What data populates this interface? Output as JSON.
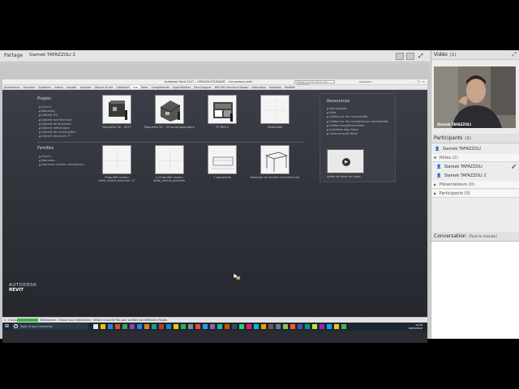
{
  "share": {
    "title": "Partage",
    "presenter": "Siamek TAFAZZOLI 2"
  },
  "revit": {
    "window_title": "Autodesk Revit 2017 – VERSION ÉTUDIANT –  Connexions aide",
    "search_placeholder": "Entrez un mot-clé ou une expression",
    "user": "siamek9 ▾",
    "ribbon_tabs": [
      "Architecture",
      "Structure",
      "Systèmes",
      "Insérer",
      "Annoter",
      "Analyser",
      "Volume et site",
      "Collaborer",
      "Vue",
      "Gérer",
      "Compléments",
      "Quantification",
      "Site Designer",
      "BIM 360 Structural Design",
      "Fabrication",
      "Autodesk",
      "Modifier"
    ],
    "active_tab_index": 8,
    "projects": {
      "title": "Projets",
      "links": [
        "Ouvrir...",
        "Nouveau...",
        "Gabarit BT...",
        "Gabarit architectural",
        "Gabarit de structure",
        "Gabarit mécanique",
        "Gabarit de construction",
        "Gabarit structure TT"
      ],
      "thumbs": [
        {
          "caption": "Maquette 30 - 2017"
        },
        {
          "caption": "Maquette 20 - 18 accompagnateur"
        },
        {
          "caption": "TP REV-2"
        },
        {
          "caption": "Modifiable"
        }
      ]
    },
    "families": {
      "title": "Familles",
      "links": [
        "Ouvrir...",
        "Nouveau...",
        "Nouveau volume conceptuel..."
      ],
      "thumbs": [
        {
          "caption": "Propriété niveau dalle_contre_plancher 17"
        },
        {
          "caption": "b_Propriété niveau dalle_contre_plancher"
        },
        {
          "caption": "1 passerelle"
        },
        {
          "caption": "Exemple de famille d'architecture"
        }
      ]
    },
    "resources": {
      "title": "Ressources",
      "links": [
        "Nouveautés",
        "Aide",
        "Vidéos sur les nouveautés",
        "Vidéos sur les compétences essentielles",
        "Vidéos supplémentaires",
        "Autodesk App Store",
        "Communauté Revit"
      ],
      "video_caption": "Vidéo de mise en route"
    },
    "logo_line1": "AUTODESK",
    "logo_line2": "REVIT",
    "status_left": "0 : 0 Modèle",
    "status_text": "Sélectionner : Cliquez pour sélectionner. Utilisez la touche Tab pour accéder aux éléments d'angle."
  },
  "taskbar": {
    "search_placeholder": "Taper ici pour rechercher",
    "time": "14:38",
    "date": "26/03/2020"
  },
  "right": {
    "video_title": "Vidéo",
    "video_count": "(1)",
    "video_name": "Siamek TAFAZZOLI",
    "participants_title": "Participants",
    "participants_count": "(2)",
    "me": "Siamek TAFAZZOLI",
    "hosts_label": "Hôtes (2)",
    "hosts": [
      "Siamek TAFAZZOLI",
      "Siamek TAFAZZOLI 2"
    ],
    "presenters_label": "Présentateurs (0)",
    "participants_label": "Participants (0)",
    "conversation_title": "Conversation",
    "conversation_scope": "(Tout le monde)"
  },
  "colors": {
    "revit_bg": "#2d3037",
    "taskbar_bg": "#1c2733",
    "accent_green": "#3cb043"
  }
}
